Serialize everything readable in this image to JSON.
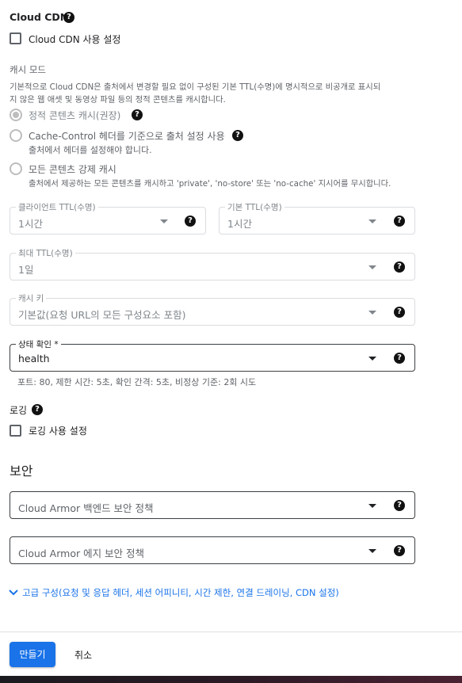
{
  "cloud_cdn": {
    "title": "Cloud CDN",
    "enable_label": "Cloud CDN 사용 설정"
  },
  "cache_mode": {
    "title": "캐시 모드",
    "description_line1": "기본적으로 Cloud CDN은 출처에서 변경할 필요 없이 구성된 기본 TTL(수명)에 명시적으로 비공개로 표시되",
    "description_line2": "지 않은 웹 애셋 및 동영상 파일 등의 정적 콘텐츠를 캐시합니다.",
    "options": [
      {
        "label": "정적 콘텐츠 캐시(권장)",
        "sub": ""
      },
      {
        "label": "Cache-Control 헤더를 기준으로 출처 설정 사용",
        "sub": "출처에서 헤더를 설정해야 합니다."
      },
      {
        "label": "모든 콘텐츠 강제 캐시",
        "sub": "출처에서 제공하는 모든 콘텐츠를 캐시하고 'private', 'no-store' 또는 'no-cache' 지시어를 무시합니다."
      }
    ]
  },
  "client_ttl": {
    "label": "클라이언트 TTL(수명)",
    "value": "1시간"
  },
  "default_ttl": {
    "label": "기본 TTL(수명)",
    "value": "1시간"
  },
  "max_ttl": {
    "label": "최대 TTL(수명)",
    "value": "1일"
  },
  "cache_key": {
    "label": "캐시 키",
    "value": "기본값(요청 URL의 모든 구성요소 포함)"
  },
  "health_check": {
    "label": "상태 확인 *",
    "value": "health",
    "hint": "포트: 80, 제한 시간: 5초, 확인 간격: 5초, 비정상 기준: 2회 시도"
  },
  "logging": {
    "title": "로깅",
    "enable_label": "로깅 사용 설정"
  },
  "security": {
    "title": "보안",
    "backend_policy_placeholder": "Cloud Armor 백엔드 보안 정책",
    "edge_policy_placeholder": "Cloud Armor 에지 보안 정책"
  },
  "advanced_link": "고급 구성(요청 및 응답 헤더, 세션 어피니티, 시간 제한, 연결 드레이닝, CDN 설정)",
  "footer": {
    "create_label": "만들기",
    "cancel_label": "취소"
  },
  "icons": {
    "help": "?"
  },
  "colors": {
    "accent": "#1a73e8"
  }
}
